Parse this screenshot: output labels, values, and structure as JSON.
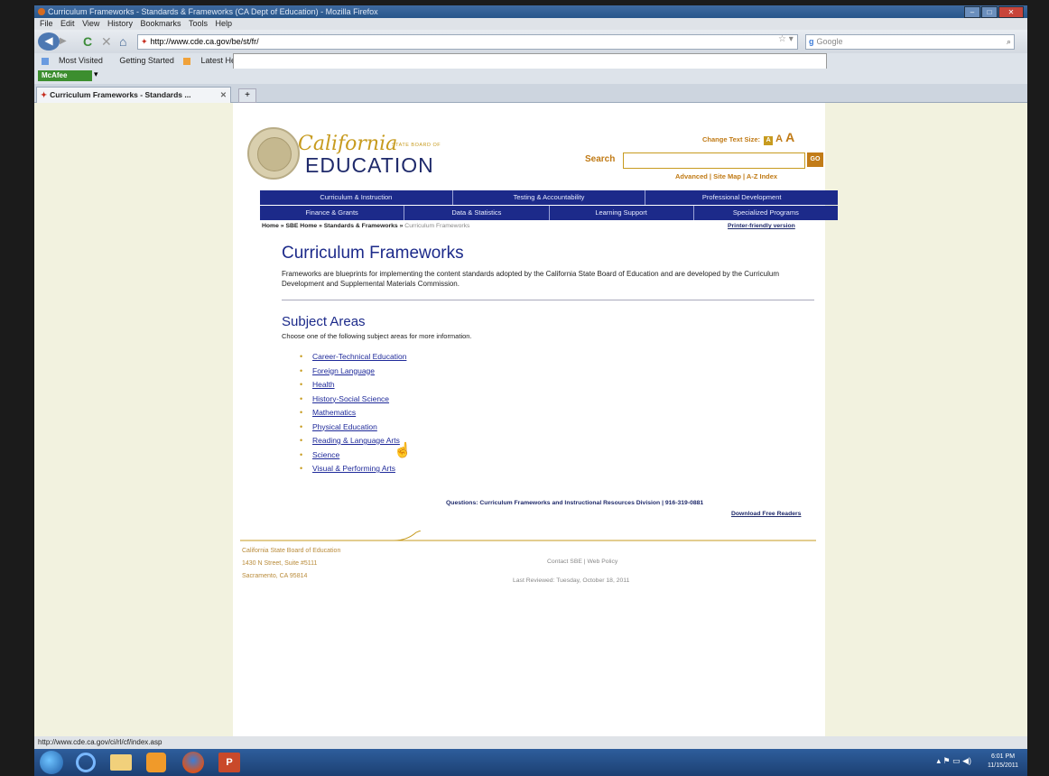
{
  "window": {
    "title": "Curriculum Frameworks - Standards & Frameworks (CA Dept of Education) - Mozilla Firefox",
    "controls": [
      "–",
      "□",
      "✕"
    ]
  },
  "menu": [
    "File",
    "Edit",
    "View",
    "History",
    "Bookmarks",
    "Tools",
    "Help"
  ],
  "nav": {
    "url": "http://www.cde.ca.gov/be/st/fr/",
    "search_engine": "Google"
  },
  "bookmarks": [
    "Most Visited",
    "Getting Started",
    "Latest Headlines"
  ],
  "mcafee_label": "McAfee",
  "tab": {
    "label": "Curriculum Frameworks - Standards ...",
    "new_tab": "+"
  },
  "site": {
    "logo_california": "California",
    "logo_sbe": "STATE BOARD OF",
    "logo_education": "EDUCATION",
    "text_size_label": "Change Text Size:",
    "search_label": "Search",
    "go_label": "GO",
    "search_links": "Advanced | Site Map | A-Z Index",
    "nav_row1": [
      "Curriculum & Instruction",
      "Testing & Accountability",
      "Professional Development"
    ],
    "nav_row2": [
      "Finance & Grants",
      "Data & Statistics",
      "Learning Support",
      "Specialized Programs"
    ],
    "breadcrumb": "Home » SBE Home » Standards & Frameworks »",
    "breadcrumb_current": "Curriculum Frameworks",
    "printer_friendly": "Printer-friendly version"
  },
  "content": {
    "title": "Curriculum Frameworks",
    "intro": "Frameworks are blueprints for implementing the content standards adopted by the California State Board of Education and are developed by the Curriculum Development and Supplemental Materials Commission.",
    "subject_heading": "Subject Areas",
    "subject_intro": "Choose one of the following subject areas for more information.",
    "subjects": [
      "Career-Technical Education",
      "Foreign Language",
      "Health",
      "History-Social Science",
      "Mathematics",
      "Physical Education",
      "Reading & Language Arts",
      "Science",
      "Visual & Performing Arts"
    ],
    "questions": "Questions:   Curriculum Frameworks and Instructional Resources Division | 916-319-0881",
    "download": "Download Free Readers"
  },
  "footer": {
    "org": "California State Board of Education",
    "street": "1430 N Street, Suite #5111",
    "city": "Sacramento, CA 95814",
    "links": "Contact SBE  |  Web Policy",
    "reviewed": "Last Reviewed: Tuesday, October 18, 2011"
  },
  "status_url": "http://www.cde.ca.gov/ci/rl/cf/index.asp",
  "clock": {
    "time": "6:01 PM",
    "date": "11/15/2011"
  },
  "colors": {
    "navy": "#1c2a8a",
    "gold": "#c79b1f",
    "page_bg": "#f2f2df"
  }
}
